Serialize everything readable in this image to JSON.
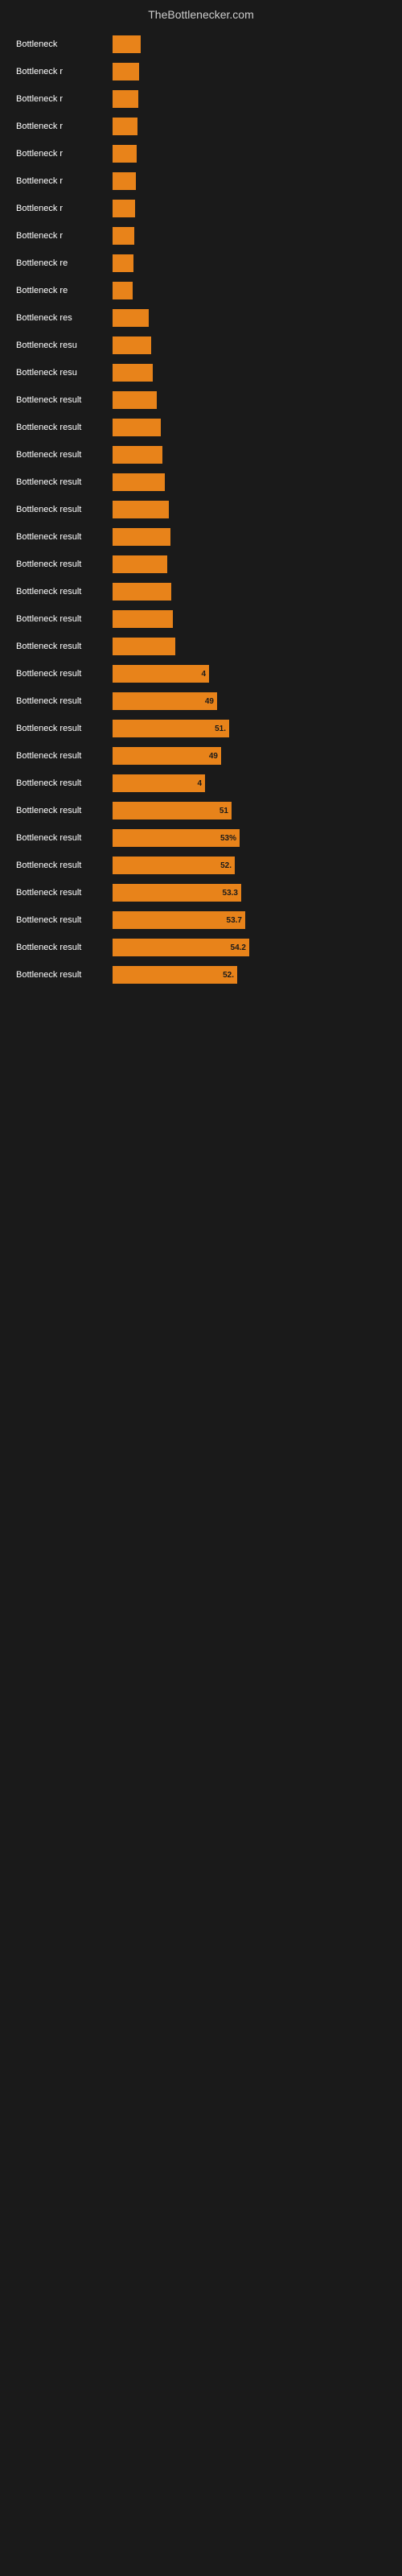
{
  "header": {
    "title": "TheBottlenecker.com"
  },
  "bars": [
    {
      "label": "Bottleneck",
      "width": 35,
      "value": "",
      "valueOutside": ""
    },
    {
      "label": "Bottleneck r",
      "width": 33,
      "value": "",
      "valueOutside": ""
    },
    {
      "label": "Bottleneck r",
      "width": 32,
      "value": "",
      "valueOutside": ""
    },
    {
      "label": "Bottleneck r",
      "width": 31,
      "value": "",
      "valueOutside": ""
    },
    {
      "label": "Bottleneck r",
      "width": 30,
      "value": "",
      "valueOutside": ""
    },
    {
      "label": "Bottleneck r",
      "width": 29,
      "value": "",
      "valueOutside": ""
    },
    {
      "label": "Bottleneck r",
      "width": 28,
      "value": "",
      "valueOutside": ""
    },
    {
      "label": "Bottleneck r",
      "width": 27,
      "value": "",
      "valueOutside": ""
    },
    {
      "label": "Bottleneck re",
      "width": 26,
      "value": "",
      "valueOutside": ""
    },
    {
      "label": "Bottleneck re",
      "width": 25,
      "value": "",
      "valueOutside": ""
    },
    {
      "label": "Bottleneck res",
      "width": 45,
      "value": "",
      "valueOutside": ""
    },
    {
      "label": "Bottleneck resu",
      "width": 48,
      "value": "",
      "valueOutside": ""
    },
    {
      "label": "Bottleneck resu",
      "width": 50,
      "value": "",
      "valueOutside": ""
    },
    {
      "label": "Bottleneck result",
      "width": 55,
      "value": "",
      "valueOutside": ""
    },
    {
      "label": "Bottleneck result",
      "width": 60,
      "value": "",
      "valueOutside": ""
    },
    {
      "label": "Bottleneck result",
      "width": 62,
      "value": "",
      "valueOutside": ""
    },
    {
      "label": "Bottleneck result",
      "width": 65,
      "value": "",
      "valueOutside": ""
    },
    {
      "label": "Bottleneck result",
      "width": 70,
      "value": "",
      "valueOutside": ""
    },
    {
      "label": "Bottleneck result",
      "width": 72,
      "value": "",
      "valueOutside": ""
    },
    {
      "label": "Bottleneck result",
      "width": 68,
      "value": "",
      "valueOutside": ""
    },
    {
      "label": "Bottleneck result",
      "width": 73,
      "value": "",
      "valueOutside": ""
    },
    {
      "label": "Bottleneck result",
      "width": 75,
      "value": "",
      "valueOutside": ""
    },
    {
      "label": "Bottleneck result",
      "width": 78,
      "value": "",
      "valueOutside": ""
    },
    {
      "label": "Bottleneck result",
      "width": 120,
      "value": "4",
      "valueOutside": ""
    },
    {
      "label": "Bottleneck result",
      "width": 130,
      "value": "49",
      "valueOutside": ""
    },
    {
      "label": "Bottleneck result",
      "width": 145,
      "value": "51.",
      "valueOutside": ""
    },
    {
      "label": "Bottleneck result",
      "width": 135,
      "value": "49",
      "valueOutside": ""
    },
    {
      "label": "Bottleneck result",
      "width": 115,
      "value": "4",
      "valueOutside": ""
    },
    {
      "label": "Bottleneck result",
      "width": 148,
      "value": "51",
      "valueOutside": ""
    },
    {
      "label": "Bottleneck result",
      "width": 158,
      "value": "53%",
      "valueOutside": ""
    },
    {
      "label": "Bottleneck result",
      "width": 152,
      "value": "52.",
      "valueOutside": ""
    },
    {
      "label": "Bottleneck result",
      "width": 160,
      "value": "53.3",
      "valueOutside": ""
    },
    {
      "label": "Bottleneck result",
      "width": 165,
      "value": "53.7",
      "valueOutside": ""
    },
    {
      "label": "Bottleneck result",
      "width": 170,
      "value": "54.2",
      "valueOutside": ""
    },
    {
      "label": "Bottleneck result",
      "width": 155,
      "value": "52.",
      "valueOutside": ""
    }
  ]
}
